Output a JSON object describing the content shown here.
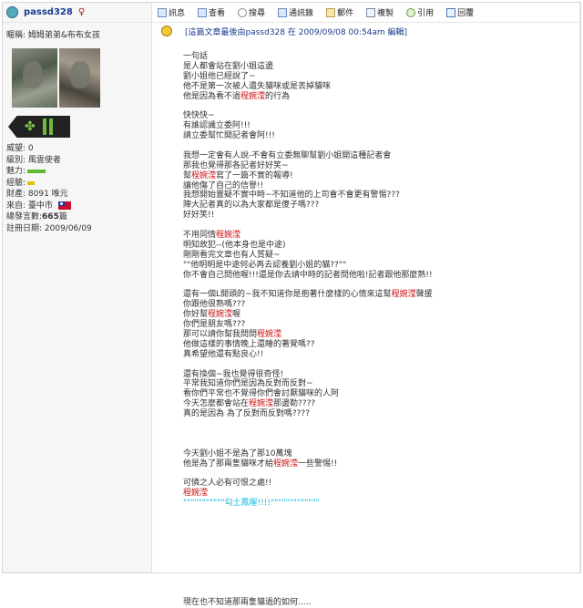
{
  "user": {
    "name": "passd328",
    "gender_symbol": "♀",
    "nickname": "暱稱: 姆姆弟弟&布布女孩",
    "stats": [
      {
        "label": "威望: 0"
      },
      {
        "label": "級別: 風雲使者"
      },
      {
        "label": "魅力: "
      },
      {
        "label": "經驗: "
      },
      {
        "label": "財產: 8091 唯元"
      },
      {
        "label": "來自: 臺中市"
      },
      {
        "label_prefix": "總發言數: ",
        "value": "665",
        "label_suffix": " 篇"
      },
      {
        "label": "註冊日期: 2009/06/09"
      }
    ]
  },
  "toolbar": [
    {
      "name": "info",
      "label": "訊息"
    },
    {
      "name": "view",
      "label": "查看"
    },
    {
      "name": "search",
      "label": "搜尋"
    },
    {
      "name": "address-book",
      "label": "通訊錄"
    },
    {
      "name": "mail",
      "label": "郵件"
    },
    {
      "name": "copy",
      "label": "複製"
    },
    {
      "name": "quote",
      "label": "引用"
    },
    {
      "name": "reply",
      "label": "回覆"
    }
  ],
  "post": {
    "edit_note": "[這篇文章最後由passd328 在 2009/09/08 00:54am 編輯]",
    "lines": [
      [
        {
          "t": "一句話"
        }
      ],
      [
        {
          "t": "是人都會站在劉小姐這邊"
        }
      ],
      [
        {
          "t": "劉小姐他已經說了~"
        }
      ],
      [
        {
          "t": "他不是第一次被人遺失貓咪或是丟掉貓咪"
        }
      ],
      [
        {
          "t": "他是因為看不過"
        },
        {
          "t": "程婉滢",
          "c": "hl"
        },
        {
          "t": "的行為"
        }
      ],
      [
        {
          "t": ""
        }
      ],
      [
        {
          "t": "快快快~"
        }
      ],
      [
        {
          "t": "有誰認識立委阿!!!"
        }
      ],
      [
        {
          "t": "請立委幫忙開記者會阿!!!"
        }
      ],
      [
        {
          "t": ""
        }
      ],
      [
        {
          "t": "我想一定會有人說-不會有立委無聊幫劉小姐開這種記者會"
        }
      ],
      [
        {
          "t": "那我也覺得那各記者好好笑~"
        }
      ],
      [
        {
          "t": "幫"
        },
        {
          "t": "程婉滢",
          "c": "hl"
        },
        {
          "t": "寫了一篇不實的報導!"
        }
      ],
      [
        {
          "t": "讓他傷了自己的信譽!!"
        }
      ],
      [
        {
          "t": "我想開始置疑不實中時~不知道他的上司會不會更有警惕???"
        }
      ],
      [
        {
          "t": "陣大記者真的以為大家都是傻子嗎???"
        }
      ],
      [
        {
          "t": "好好笑!!"
        }
      ],
      [
        {
          "t": ""
        }
      ],
      [
        {
          "t": "不用同情"
        },
        {
          "t": "程婉滢",
          "c": "hl"
        }
      ],
      [
        {
          "t": "明知故犯--(他本身也是中途)"
        }
      ],
      [
        {
          "t": "剛剛看完文章也有人質疑~"
        }
      ],
      [
        {
          "t": "\"\"他明明是中途何必再去認養劉小姐的貓??\"\""
        }
      ],
      [
        {
          "t": "你不會自己問他喔!!!還是你去請中時的記者問他啦!記者跟他那麼熟!!"
        }
      ],
      [
        {
          "t": ""
        }
      ],
      [
        {
          "t": "還有一個L開頭的~我不知道你是抱著什麼樣的心情來這幫"
        },
        {
          "t": "程婉滢",
          "c": "hl"
        },
        {
          "t": "聲援"
        }
      ],
      [
        {
          "t": "你跟他很熟嗎???"
        }
      ],
      [
        {
          "t": "你好幫"
        },
        {
          "t": "程婉滢",
          "c": "hl"
        },
        {
          "t": "喔"
        }
      ],
      [
        {
          "t": "你們是朋友嗎???"
        }
      ],
      [
        {
          "t": "那可以請你幫我問問"
        },
        {
          "t": "程婉滢",
          "c": "hl"
        }
      ],
      [
        {
          "t": "他做這樣的事情晚上還睡的著覺嗎??"
        }
      ],
      [
        {
          "t": "真希望他還有點良心!!"
        }
      ],
      [
        {
          "t": ""
        }
      ],
      [
        {
          "t": "還有換個~我也覺得很奇怪!"
        }
      ],
      [
        {
          "t": "平常我知道你們是因為反對而反對~"
        }
      ],
      [
        {
          "t": "看你們平常也不覺得你們會討厭貓咪的人阿"
        }
      ],
      [
        {
          "t": "今天怎麼都會站在"
        },
        {
          "t": "程婉滢",
          "c": "hl"
        },
        {
          "t": "那邊勒????"
        }
      ],
      [
        {
          "t": "真的是因為 為了反對而反對嗎????"
        }
      ],
      [
        {
          "t": ""
        }
      ],
      [
        {
          "t": ""
        }
      ],
      [
        {
          "t": ""
        }
      ],
      [
        {
          "t": "今天劉小姐不是為了那10萬塊"
        }
      ],
      [
        {
          "t": "他是為了那兩隻貓咪才給"
        },
        {
          "t": "程婉滢",
          "c": "hl"
        },
        {
          "t": "一些警惕!!"
        }
      ],
      [
        {
          "t": ""
        }
      ],
      [
        {
          "t": "可憐之人必有可恨之處!!"
        }
      ],
      [
        {
          "t": "程婉滢",
          "c": "hl"
        }
      ],
      [
        {
          "t": "\"\"\"\"\"\"\"\"\"\"\"勾土鳳喔!!!!\"\"\"\"\"\"\"\"\"\"\"\"\"",
          "c": "cy"
        }
      ],
      [
        {
          "t": ""
        }
      ],
      [
        {
          "t": ""
        }
      ],
      [
        {
          "t": ""
        }
      ],
      [
        {
          "t": ""
        }
      ],
      [
        {
          "t": ""
        }
      ],
      [
        {
          "t": ""
        }
      ],
      [
        {
          "t": ""
        }
      ],
      [
        {
          "t": ""
        }
      ],
      [
        {
          "t": ""
        }
      ],
      [
        {
          "t": "現在也不知道那兩隻貓過的如何....."
        }
      ]
    ]
  }
}
